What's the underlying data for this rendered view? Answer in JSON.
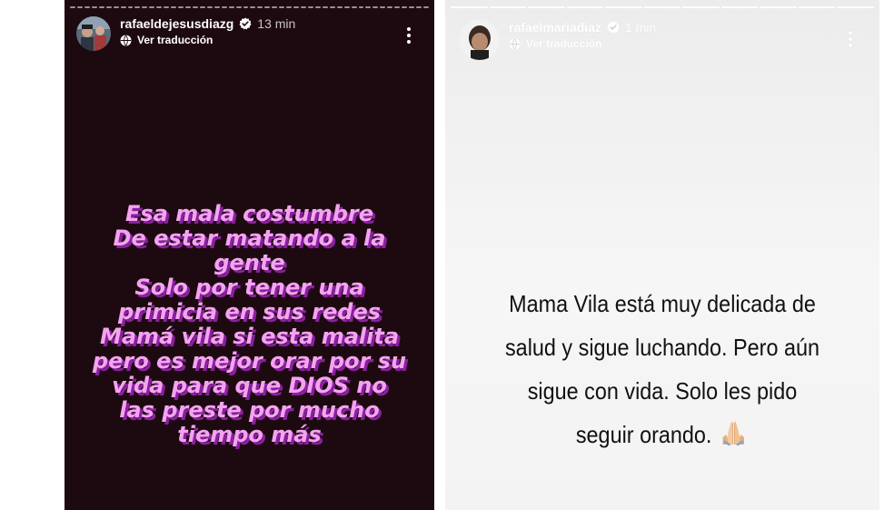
{
  "stories": [
    {
      "username": "rafaeldejesusdiazg",
      "time": "13 min",
      "translate_label": "Ver traducción",
      "text_lines": [
        "Esa mala costumbre",
        "De estar matando a la",
        "gente",
        "Solo por tener una",
        "primicia en sus redes",
        "Mamá vila si esta malita",
        "pero es mejor orar por su",
        "vida para que DIOS no",
        "las preste por mucho",
        "tiempo más"
      ],
      "background": "#1d0a10",
      "text_color": "#f3a4ef",
      "shadow_color": "#8b1fa1"
    },
    {
      "username": "rafaelmariadiaz",
      "time": "1 min",
      "translate_label": "Ver traducción",
      "text_lines": [
        "Mama Vila está muy delicada de",
        "salud y sigue luchando. Pero aún",
        "sigue con vida. Solo les pido",
        "seguir orando."
      ],
      "emoji": "folded-hands-icon",
      "background": "#efefef",
      "text_color": "#111111"
    }
  ]
}
